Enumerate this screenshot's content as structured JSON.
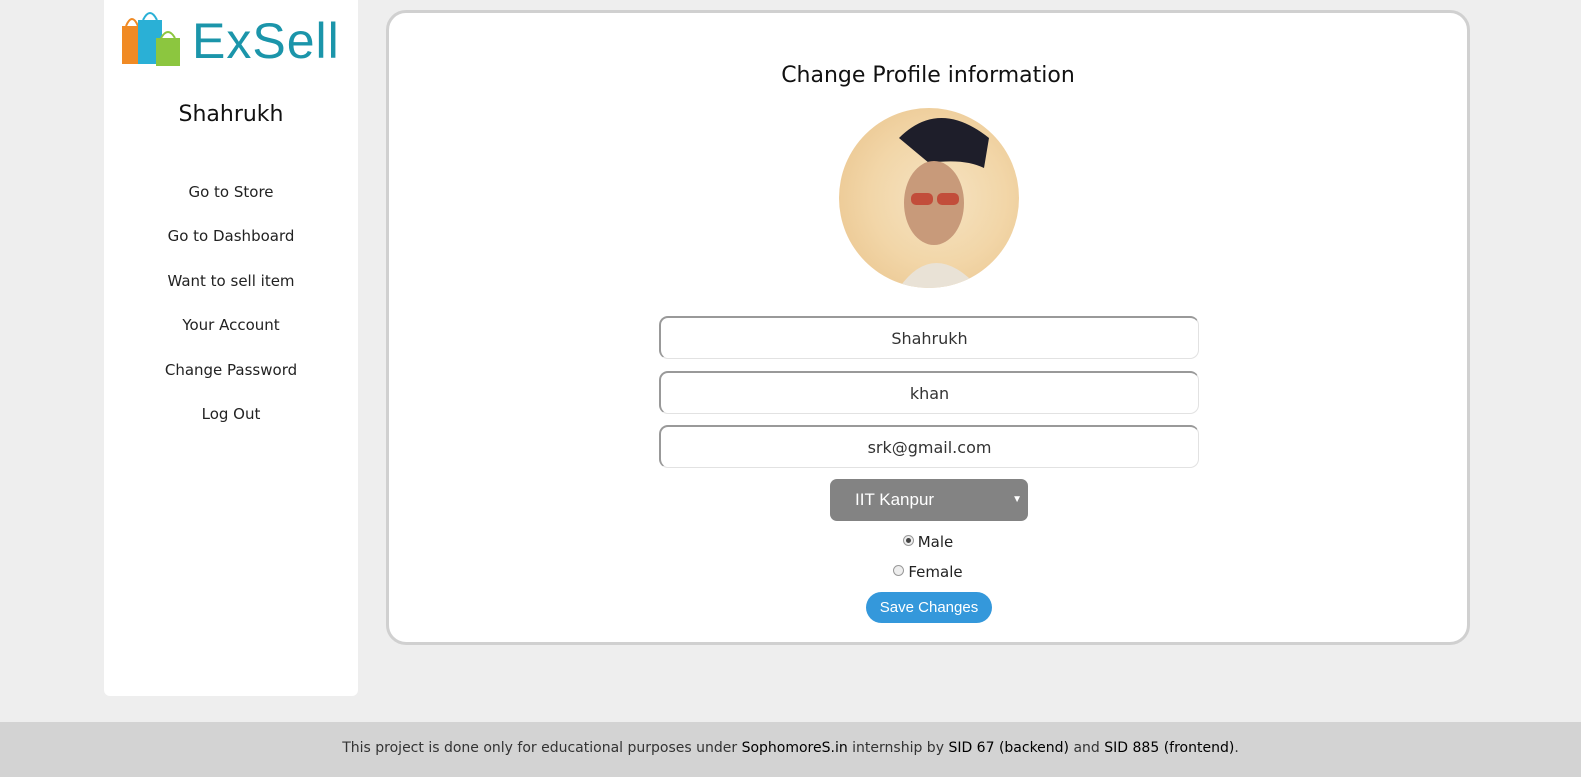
{
  "brand": {
    "name": "ExSell",
    "colors": {
      "text": "#1b95aa",
      "bag1": "#f08a24",
      "bag2": "#2ab0d6",
      "bag3": "#8cc63f"
    }
  },
  "sidebar": {
    "username": "Shahrukh",
    "items": [
      {
        "label": "Go to Store"
      },
      {
        "label": "Go to Dashboard"
      },
      {
        "label": "Want to sell item"
      },
      {
        "label": "Your Account"
      },
      {
        "label": "Change Password"
      },
      {
        "label": "Log Out"
      }
    ]
  },
  "form": {
    "title": "Change Profile information",
    "first_name": "Shahrukh",
    "last_name": "khan",
    "email": "srk@gmail.com",
    "college": "IIT Kanpur",
    "gender": {
      "options": [
        {
          "label": "Male",
          "checked": true
        },
        {
          "label": "Female",
          "checked": false
        }
      ]
    },
    "save_label": "Save Changes",
    "accent": "#3498db"
  },
  "footer": {
    "t1": "This project is done only for educational purposes under ",
    "link": "SophomoreS.in",
    "t2": " internship by ",
    "sid1": "SID 67 (backend)",
    "t3": " and ",
    "sid2": "SID 885 (frontend)",
    "t4": "."
  }
}
